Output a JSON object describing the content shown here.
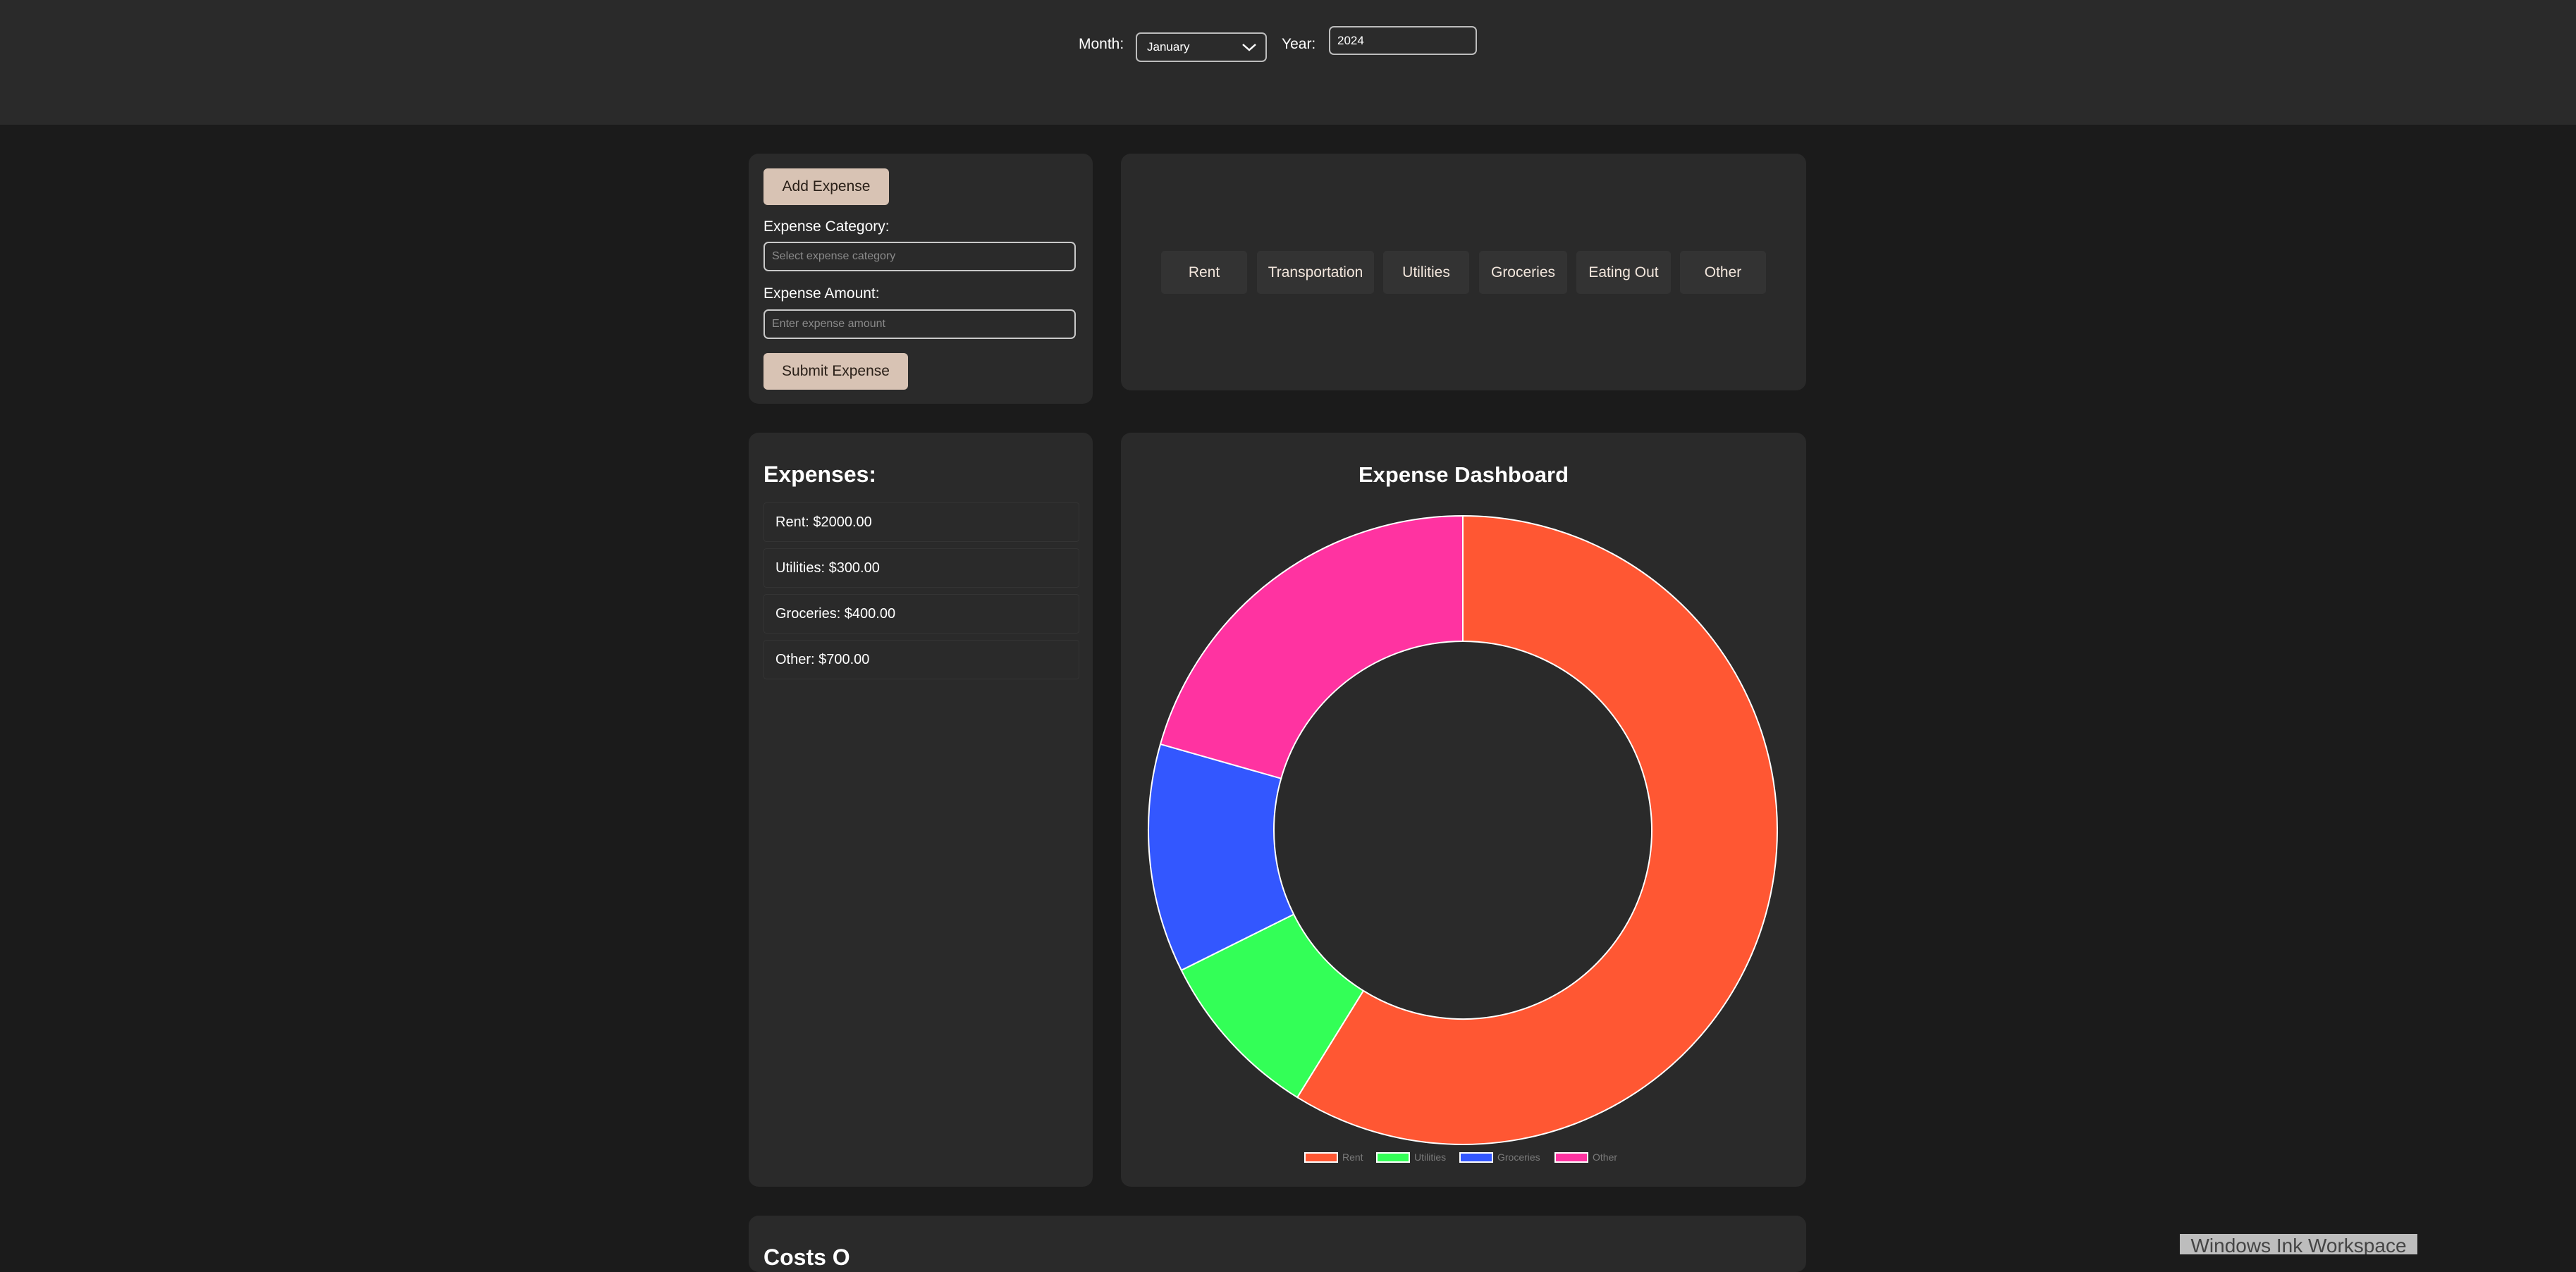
{
  "header": {
    "month_label": "Month:",
    "month_value": "January",
    "year_label": "Year:",
    "year_value": "2024"
  },
  "expense_form": {
    "add_button": "Add Expense",
    "category_label": "Expense Category:",
    "category_placeholder": "Select expense category",
    "amount_label": "Expense Amount:",
    "amount_placeholder": "Enter expense amount",
    "submit_button": "Submit Expense"
  },
  "categories": [
    "Rent",
    "Transportation",
    "Utilities",
    "Groceries",
    "Eating Out",
    "Other"
  ],
  "expenses": {
    "title": "Expenses:",
    "items": [
      "Rent: $2000.00",
      "Utilities: $300.00",
      "Groceries: $400.00",
      "Other: $700.00"
    ]
  },
  "dashboard": {
    "title": "Expense Dashboard"
  },
  "chart_data": {
    "type": "pie",
    "subtype": "doughnut",
    "title": "Expense Dashboard",
    "categories": [
      "Rent",
      "Utilities",
      "Groceries",
      "Other"
    ],
    "values": [
      2000,
      300,
      400,
      700
    ],
    "colors": [
      "#ff5733",
      "#33ff57",
      "#3357ff",
      "#ff33a1"
    ],
    "legend": "bottom"
  },
  "bottom_panel": {
    "partial_title": "Costs O"
  },
  "taskbar": {
    "ink_workspace": "Windows Ink Workspace"
  },
  "colors": {
    "background": "#1b1b1b",
    "panel": "#2a2a2a",
    "accent_button": "#d8c3b4"
  }
}
